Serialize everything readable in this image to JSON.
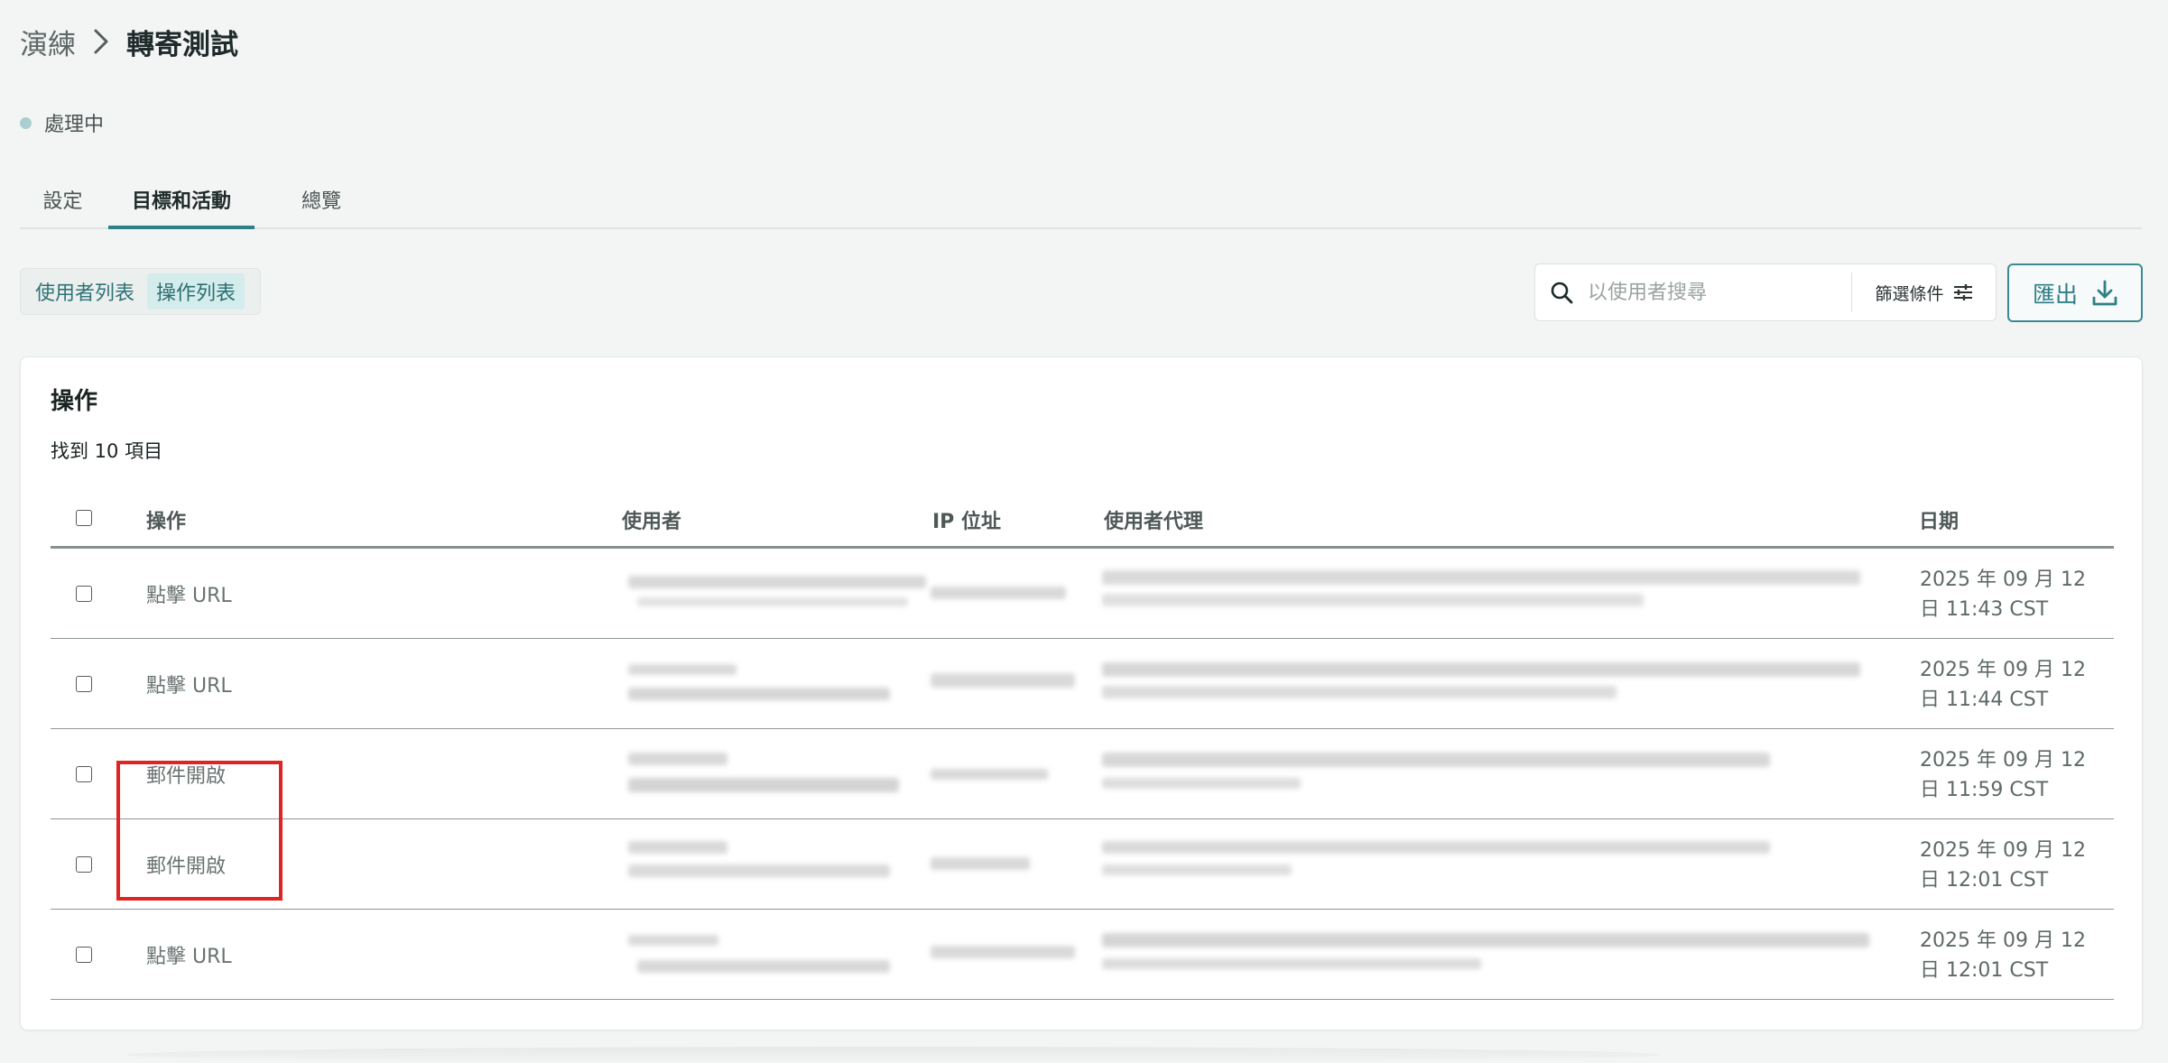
{
  "breadcrumb": {
    "parent": "演練",
    "current": "轉寄測試"
  },
  "status": {
    "label": "處理中",
    "color": "#a9cfd1"
  },
  "tabs": [
    {
      "label": "設定",
      "active": false
    },
    {
      "label": "目標和活動",
      "active": true
    },
    {
      "label": "總覽",
      "active": false
    }
  ],
  "segment": {
    "users_label": "使用者列表",
    "actions_label": "操作列表",
    "active": "操作列表"
  },
  "search": {
    "placeholder": "以使用者搜尋",
    "icon": "search-icon"
  },
  "filter": {
    "label": "篩選條件",
    "icon": "sliders-icon"
  },
  "export": {
    "label": "匯出",
    "icon": "download-icon"
  },
  "card": {
    "title": "操作",
    "result_count": "找到 10 項目"
  },
  "table": {
    "columns": {
      "action": "操作",
      "user": "使用者",
      "ip": "IP 位址",
      "user_agent": "使用者代理",
      "date": "日期"
    },
    "rows": [
      {
        "action": "點擊 URL",
        "date_line1": "2025 年 09 月 12",
        "date_line2": "日 11:43 CST"
      },
      {
        "action": "點擊 URL",
        "date_line1": "2025 年 09 月 12",
        "date_line2": "日 11:44 CST"
      },
      {
        "action": "郵件開啟",
        "date_line1": "2025 年 09 月 12",
        "date_line2": "日 11:59 CST"
      },
      {
        "action": "郵件開啟",
        "date_line1": "2025 年 09 月 12",
        "date_line2": "日 12:01 CST"
      },
      {
        "action": "點擊 URL",
        "date_line1": "2025 年 09 月 12",
        "date_line2": "日 12:01 CST"
      }
    ]
  },
  "colors": {
    "accent": "#2f7f86",
    "highlight": "#e02424",
    "background": "#f3f5f4"
  }
}
